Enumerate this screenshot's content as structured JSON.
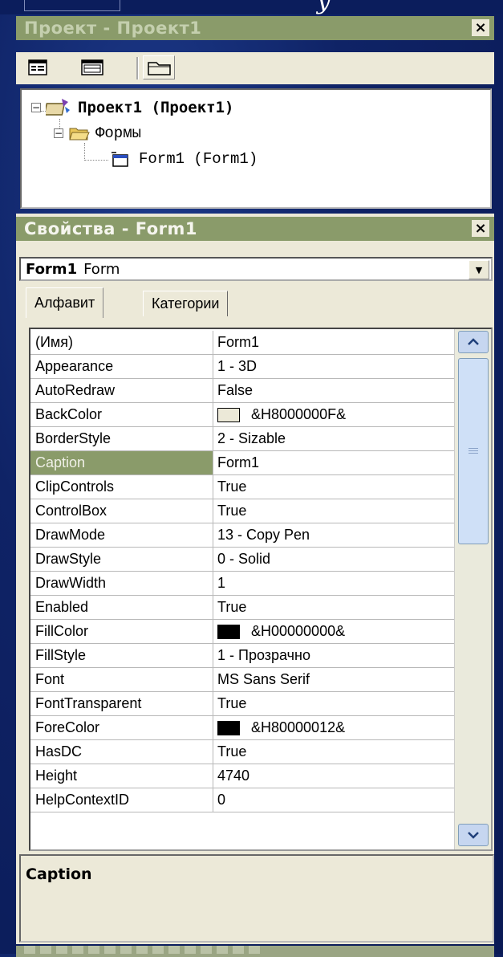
{
  "decor": {
    "script_fragment": "y"
  },
  "project_panel": {
    "title": "Проект - Проект1",
    "close_label": "×",
    "toolbar": {
      "icons": [
        "view-code-icon",
        "view-object-icon",
        "toggle-folders-icon"
      ]
    },
    "tree": {
      "root": "Проект1 (Проект1)",
      "folder": "Формы",
      "item": "Form1 (Form1)"
    }
  },
  "properties_panel": {
    "title": "Свойства - Form1",
    "close_label": "×",
    "object_selector": {
      "name": "Form1",
      "type": "Form"
    },
    "tabs": [
      "Алфавит",
      "Категории"
    ],
    "rows": [
      {
        "name": "(Имя)",
        "value": "Form1"
      },
      {
        "name": "Appearance",
        "value": "1 - 3D"
      },
      {
        "name": "AutoRedraw",
        "value": "False"
      },
      {
        "name": "BackColor",
        "value": "&H8000000F&",
        "swatch": "#ece9d8"
      },
      {
        "name": "BorderStyle",
        "value": "2 - Sizable"
      },
      {
        "name": "Caption",
        "value": "Form1",
        "selected": true
      },
      {
        "name": "ClipControls",
        "value": "True"
      },
      {
        "name": "ControlBox",
        "value": "True"
      },
      {
        "name": "DrawMode",
        "value": "13 - Copy Pen"
      },
      {
        "name": "DrawStyle",
        "value": "0 - Solid"
      },
      {
        "name": "DrawWidth",
        "value": "1"
      },
      {
        "name": "Enabled",
        "value": "True"
      },
      {
        "name": "FillColor",
        "value": "&H00000000&",
        "swatch": "#000000"
      },
      {
        "name": "FillStyle",
        "value": "1 - Прозрачно"
      },
      {
        "name": "Font",
        "value": "MS Sans Serif"
      },
      {
        "name": "FontTransparent",
        "value": "True"
      },
      {
        "name": "ForeColor",
        "value": "&H80000012&",
        "swatch": "#000000"
      },
      {
        "name": "HasDC",
        "value": "True"
      },
      {
        "name": "Height",
        "value": "4740"
      },
      {
        "name": "HelpContextID",
        "value": "0"
      }
    ],
    "description_title": "Caption"
  },
  "colors": {
    "background": "#0f2366",
    "titlebar": "#8a9b6a",
    "panel": "#ece9d8",
    "selection": "#8a9b6a"
  }
}
